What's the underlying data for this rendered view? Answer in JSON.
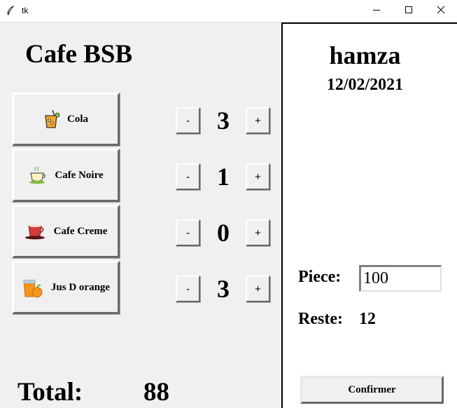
{
  "window": {
    "title": "tk",
    "app_icon": "feather-icon",
    "controls": [
      "minimize-icon",
      "maximize-icon",
      "close-icon"
    ]
  },
  "main": {
    "title": "Cafe BSB",
    "items": [
      {
        "label": "Cola",
        "icon": "cola-drink-icon",
        "quantity": "3",
        "minus_label": "-",
        "plus_label": "+"
      },
      {
        "label": "Cafe Noire",
        "icon": "tea-cup-icon",
        "quantity": "1",
        "minus_label": "-",
        "plus_label": "+"
      },
      {
        "label": "Cafe Creme",
        "icon": "coffee-cup-icon",
        "quantity": "0",
        "minus_label": "-",
        "plus_label": "+"
      },
      {
        "label": "Jus D orange",
        "icon": "orange-juice-icon",
        "quantity": "3",
        "minus_label": "-",
        "plus_label": "+"
      }
    ],
    "total_label": "Total:",
    "total_value": "88"
  },
  "panel": {
    "user_name": "hamza",
    "date": "12/02/2021",
    "piece_label": "Piece:",
    "piece_value": "100",
    "reste_label": "Reste:",
    "reste_value": "12",
    "confirm_label": "Confirmer"
  }
}
